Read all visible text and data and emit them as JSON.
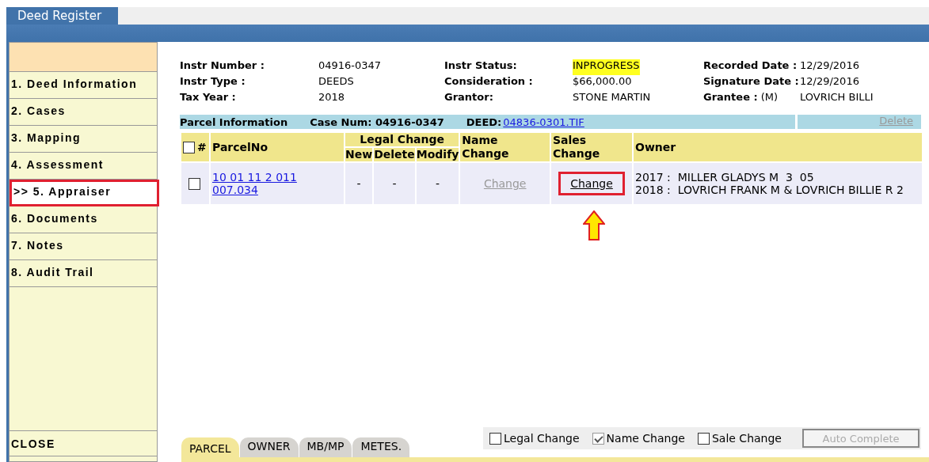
{
  "app_tab": {
    "label": "Deed Register",
    "selected": true
  },
  "sidebar": {
    "items": [
      {
        "label": "1. Deed Information",
        "selected": false
      },
      {
        "label": "2. Cases",
        "selected": false
      },
      {
        "label": "3. Mapping",
        "selected": false
      },
      {
        "label": "4. Assessment",
        "selected": false
      },
      {
        "label": ">> 5. Appraiser",
        "selected": true
      },
      {
        "label": "6. Documents",
        "selected": false
      },
      {
        "label": "7. Notes",
        "selected": false
      },
      {
        "label": "8. Audit Trail",
        "selected": false
      }
    ],
    "close": "CLOSE"
  },
  "info": [
    {
      "label": "Instr Number :",
      "value": "04916-0347",
      "highlighted": false
    },
    {
      "label": "Instr Status:",
      "value": "INPROGRESS",
      "highlighted": true
    },
    {
      "label": "Recorded Date :",
      "value": "12/29/2016",
      "highlighted": false
    },
    {
      "label": "Instr Type :",
      "value": "DEEDS",
      "highlighted": false
    },
    {
      "label": "Consideration :",
      "value": "$66,000.00",
      "highlighted": false
    },
    {
      "label": "Signature Date :",
      "value": "12/29/2016",
      "highlighted": false
    },
    {
      "label": "Tax Year :",
      "value": "2018",
      "highlighted": false
    },
    {
      "label": "Grantor:",
      "value": "STONE MARTIN",
      "highlighted": false
    },
    {
      "label": "Grantee :",
      "prefix": "(M)",
      "value": "LOVRICH BILLI",
      "highlighted": false
    }
  ],
  "parcel_bar": {
    "title": "Parcel Information",
    "case_num": "Case Num: 04916-0347",
    "deed_label": "DEED:",
    "deed_link": " 04836-0301.TIF",
    "delete": {
      "label": "Delete",
      "disabled": true
    }
  },
  "table": {
    "select_all_checked": false,
    "number_header": "#",
    "parcel_header": "ParcelNo",
    "legal_header": "Legal Change",
    "legal_sub": [
      "New",
      "Delete",
      "Modify"
    ],
    "name_header": "Name Change",
    "sales_header": "Sales Change",
    "owner_header": "Owner",
    "rows": [
      {
        "checked": false,
        "parcel_no": "10 01 11 2 011 007.034",
        "legal": [
          "-",
          "-",
          "-"
        ],
        "name_change": {
          "label": "Change",
          "disabled": true,
          "highlighted": false
        },
        "sales_change": {
          "label": "Change",
          "disabled": false,
          "highlighted": true
        },
        "owners": [
          "2017 :  MILLER GLADYS M  3  05",
          "2018 :  LOVRICH FRANK M & LOVRICH BILLIE R 2"
        ]
      }
    ]
  },
  "bottom_tabs": [
    {
      "label": "PARCEL",
      "selected": true
    },
    {
      "label": "OWNER",
      "selected": false
    },
    {
      "label": "MB/MP",
      "selected": false
    },
    {
      "label": "METES.",
      "selected": false
    }
  ],
  "change_checks": [
    {
      "label": "Legal Change",
      "checked": false,
      "disabled": false
    },
    {
      "label": "Name Change",
      "checked": true,
      "disabled": true
    },
    {
      "label": "Sale Change",
      "checked": false,
      "disabled": false
    }
  ],
  "auto_complete": {
    "label": "Auto Complete",
    "disabled": true
  }
}
